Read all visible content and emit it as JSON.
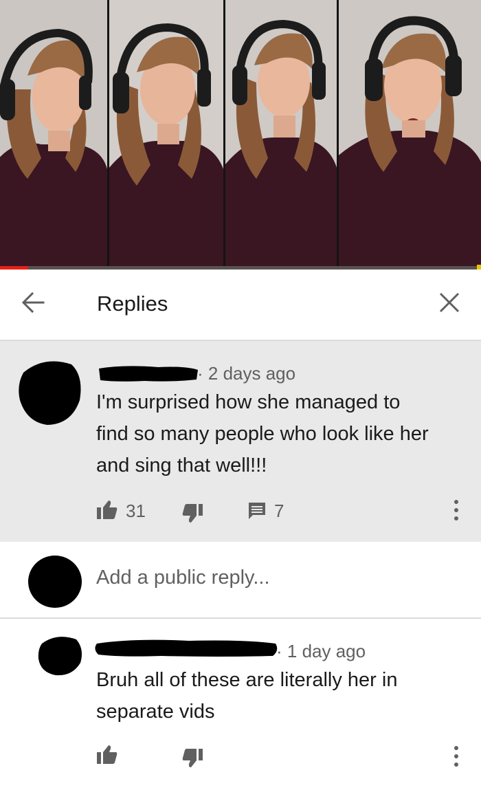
{
  "header": {
    "title": "Replies"
  },
  "top_comment": {
    "author": "",
    "time": "2 days ago",
    "text_lines": [
      "I'm surprised how she managed to",
      "find so many people who look like her",
      "and sing that well!!!"
    ],
    "likes": "31",
    "replies": "7"
  },
  "add_reply": {
    "placeholder": "Add a public reply..."
  },
  "reply": {
    "author": "",
    "time": "1 day ago",
    "text_lines": [
      "Bruh all of these are literally her in",
      "separate vids"
    ]
  },
  "video": {
    "progress_fraction": 0.058
  },
  "colors": {
    "progress": "#e62117",
    "highlight_bg": "#e9e9e9",
    "secondary_text": "#606060"
  },
  "icons": {
    "back": "arrow-left-icon",
    "close": "close-icon",
    "like": "thumbs-up-icon",
    "dislike": "thumbs-down-icon",
    "reply": "comment-icon",
    "more": "more-vert-icon"
  }
}
